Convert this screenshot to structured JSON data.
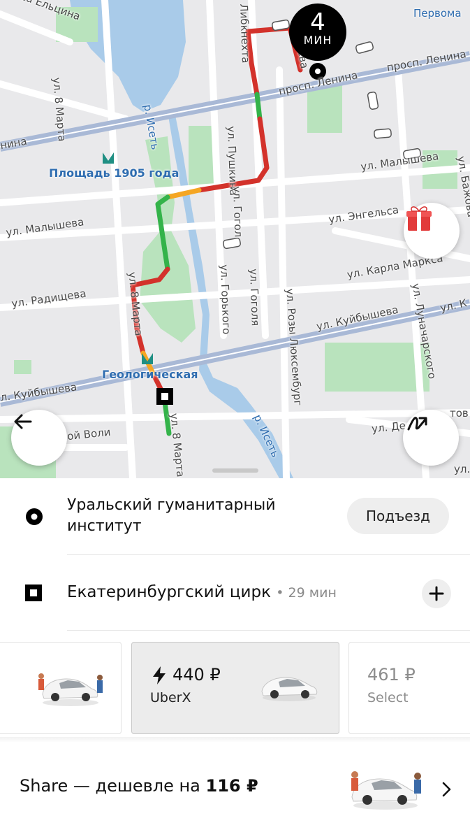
{
  "map": {
    "eta": {
      "value": "4",
      "unit": "МИН"
    },
    "labels": {
      "elcina": "са Ельцина",
      "pervomay": "Первома",
      "lenina1": "просп. Ленина",
      "lenina2": "просп. Ленина",
      "lenina_left": "нина",
      "marta_top": "ул. 8 Марта",
      "liebknecht": "Либкнехта",
      "station1905": "Площадь 1905 года",
      "pushkina": "ул. Пушкина",
      "malysheva_r": "ул. Малышева",
      "malysheva_l": "ул. Малышева",
      "bazhova": "ул. Бажова",
      "gogol1": "ул. Гогол",
      "engelsa": "ул. Энгельса",
      "karla_marksa": "ул. Карла Маркса",
      "radishcheva": "ул. Радищева",
      "gorkogo": "ул. Горького",
      "gogolya": "ул. Гоголя",
      "rozy": "ул. Розы Люксембург",
      "lunacharskogo": "ул. Луначарского",
      "marta_mid": "ул. 8 Марта",
      "kuibysheva_r": "ул. Куйбышева",
      "kuibysheva_r2": "ул. К",
      "kuibysheva_l": "л. Куйбышева",
      "geologicheskaya": "Геологическая",
      "iset1": "р. Исеть",
      "iset2": "р. Исеть",
      "voli": "ой Воли",
      "marta_bot": "ул. 8 Марта",
      "dekabr": "ул. Де",
      "tov": "тов",
      "sheva": "шева",
      "ul_frag": "ул."
    }
  },
  "pickup": {
    "title": "Уральский гуманитарный институт",
    "action": "Подъезд"
  },
  "destination": {
    "title": "Екатеринбургский цирк",
    "duration": "• 29 мин"
  },
  "options": [
    {
      "name": "",
      "price": ""
    },
    {
      "name": "UberX",
      "price": "440 ₽"
    },
    {
      "name": "Select",
      "price": "461 ₽"
    }
  ],
  "share": {
    "prefix": "Share — дешевле на ",
    "amount": "116 ₽"
  },
  "colors": {
    "route_red": "#d3322b",
    "route_green": "#34b34a",
    "route_orange": "#f5a623",
    "water": "#a9cbe9",
    "park": "#b9e3bd",
    "avenue": "#a9b9d6"
  }
}
